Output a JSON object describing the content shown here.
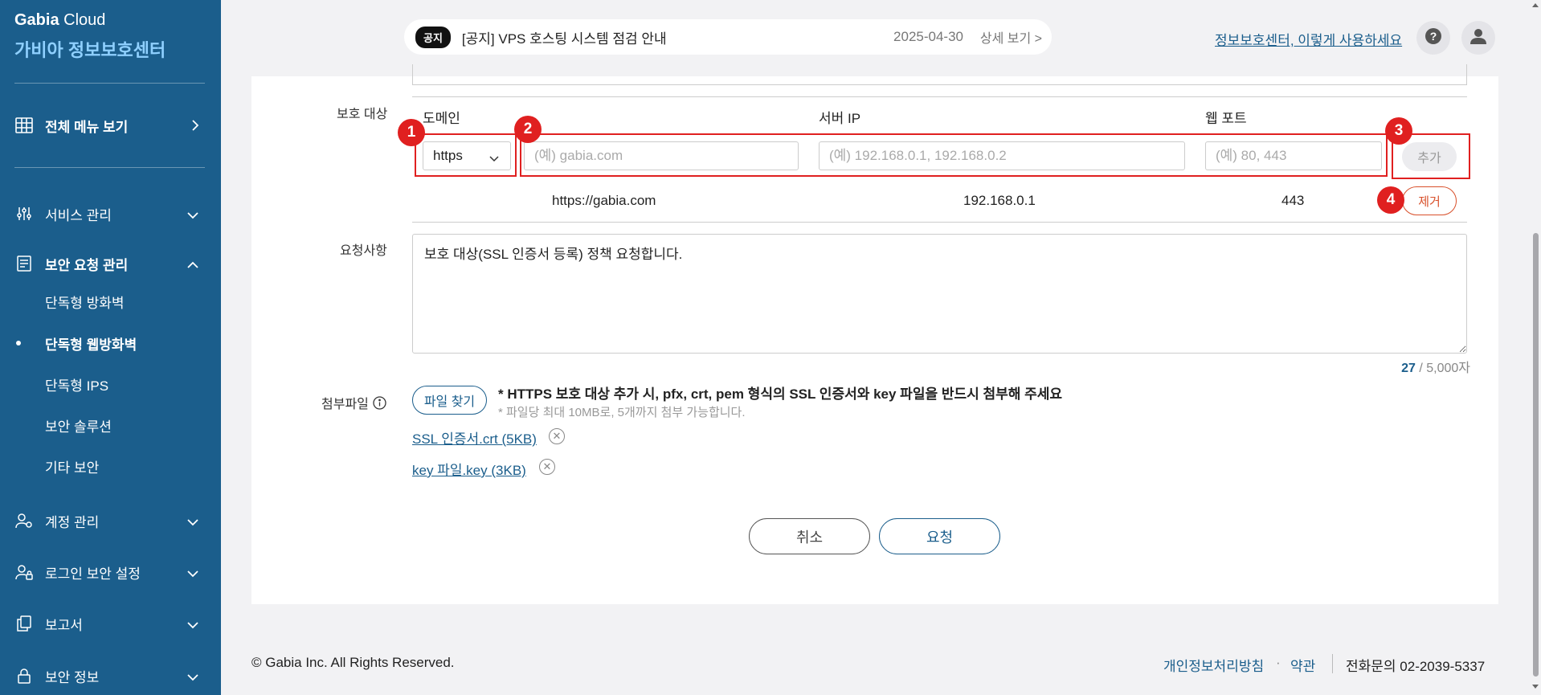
{
  "brand": {
    "company": "Gabia",
    "product": "Cloud",
    "title": "가비아 정보보호센터"
  },
  "sidebar": {
    "all_menu": "전체 메뉴 보기",
    "items": [
      {
        "label": "서비스 관리",
        "icon": "sliders-icon"
      },
      {
        "label": "보안 요청 관리",
        "icon": "document-icon"
      },
      {
        "label": "계정 관리",
        "icon": "user-gear-icon"
      },
      {
        "label": "로그인 보안 설정",
        "icon": "user-lock-icon"
      },
      {
        "label": "보고서",
        "icon": "copy-icon"
      },
      {
        "label": "보안 정보",
        "icon": "lock-icon"
      }
    ],
    "sub_items": [
      {
        "label": "단독형 방화벽"
      },
      {
        "label": "단독형 웹방화벽",
        "active": true
      },
      {
        "label": "단독형 IPS"
      },
      {
        "label": "보안 솔루션"
      },
      {
        "label": "기타 보안"
      }
    ]
  },
  "notice": {
    "badge": "공지",
    "title": "[공지] VPS 호스팅 시스템 점검 안내",
    "date": "2025-04-30",
    "more": "상세 보기 >"
  },
  "header": {
    "help_link": "정보보호센터, 이렇게 사용하세요"
  },
  "form": {
    "target_label": "보호 대상",
    "columns": {
      "domain": "도메인",
      "server_ip": "서버 IP",
      "web_port": "웹 포트"
    },
    "protocol_selected": "https",
    "domain_placeholder": "(예) gabia.com",
    "ip_placeholder": "(예) 192.168.0.1, 192.168.0.2",
    "port_placeholder": "(예) 80, 443",
    "add_label": "추가",
    "entry": {
      "domain": "https://gabia.com",
      "ip": "192.168.0.1",
      "port": "443"
    },
    "remove_label": "제거",
    "request_label": "요청사항",
    "request_text": "보호 대상(SSL 인증서 등록) 정책 요청합니다.",
    "char_count": "27",
    "char_max": " / 5,000자",
    "attach_label": "첨부파일",
    "file_button": "파일 찾기",
    "file_note": "* HTTPS 보호 대상 추가 시, pfx, crt, pem 형식의 SSL 인증서와 key 파일을 반드시 첨부해 주세요",
    "file_sub": "* 파일당 최대 10MB로, 5개까지 첨부 가능합니다.",
    "files": [
      {
        "name": "SSL 인증서.crt (5KB)"
      },
      {
        "name": "key 파일.key (3KB)"
      }
    ],
    "cancel_label": "취소",
    "submit_label": "요청"
  },
  "annotations": [
    "1",
    "2",
    "3",
    "4"
  ],
  "footer": {
    "copyright": "© Gabia Inc. All Rights Reserved.",
    "privacy": "개인정보처리방침",
    "dot": "·",
    "terms": "약관",
    "phone": "전화문의 02-2039-5337"
  },
  "colors": {
    "sidebar": "#1b5e8c",
    "accent": "#1b5e8c",
    "highlight": "#e02020",
    "remove": "#d8502b"
  }
}
